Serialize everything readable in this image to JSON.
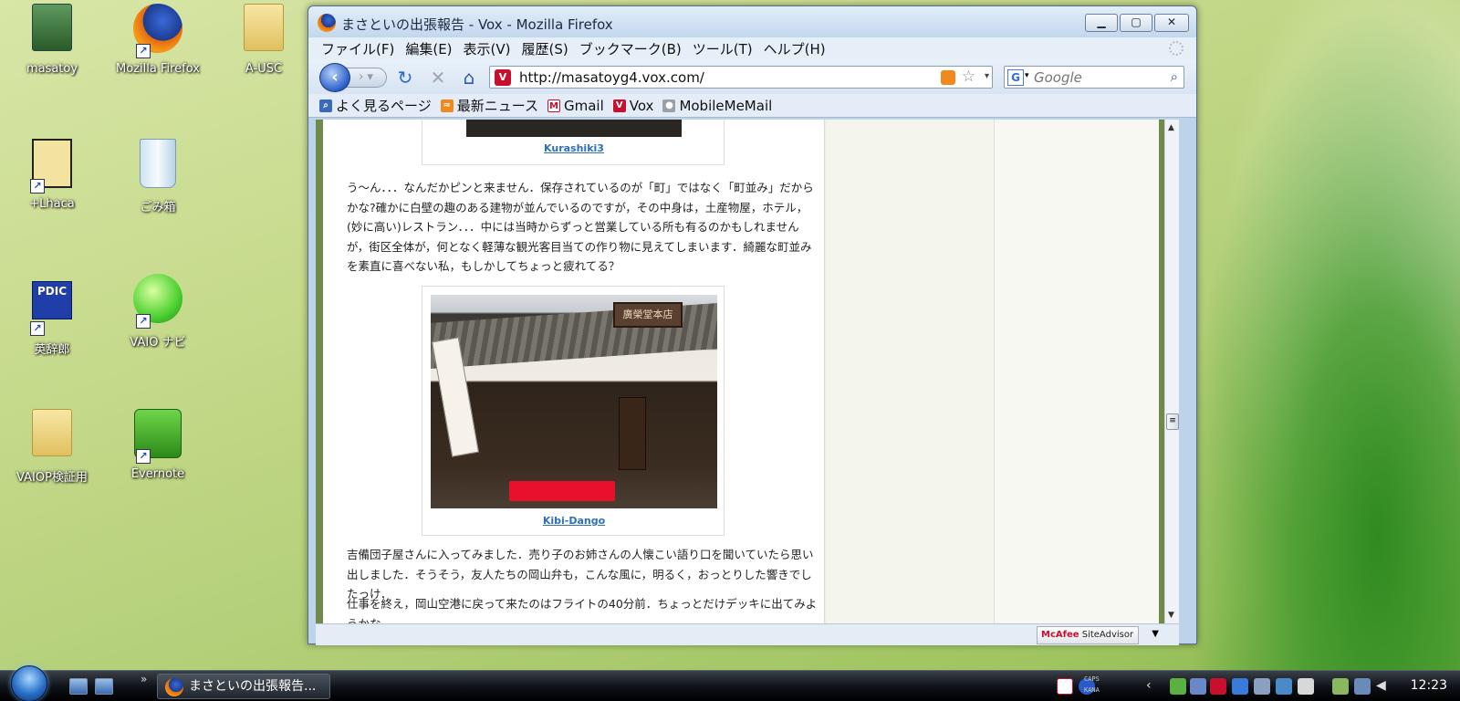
{
  "desktop": {
    "icons": [
      {
        "label": "masatoy"
      },
      {
        "label": "Mozilla Firefox"
      },
      {
        "label": "A-USC"
      },
      {
        "label": "+Lhaca"
      },
      {
        "label": "ごみ箱"
      },
      {
        "label": "英辞郎"
      },
      {
        "label": "VAIO ナビ"
      },
      {
        "label": "VAIOP検証用"
      },
      {
        "label": "Evernote"
      }
    ],
    "pdic_text": "PDIC"
  },
  "window": {
    "title": "まさといの出張報告 - Vox - Mozilla Firefox",
    "minimize": "▁",
    "maximize": "▢",
    "close": "✕"
  },
  "menu": [
    "ファイル(F)",
    "編集(E)",
    "表示(V)",
    "履歴(S)",
    "ブックマーク(B)",
    "ツール(T)",
    "ヘルプ(H)"
  ],
  "navbar": {
    "url": "http://masatoyg4.vox.com/",
    "search_placeholder": "Google",
    "vox_letter": "V",
    "google_letter": "G"
  },
  "bookmarks": [
    "よく見るページ",
    "最新ニュース",
    "Gmail",
    "Vox",
    "MobileMeMail"
  ],
  "post": {
    "caption1": "Kurashiki3",
    "para1": "う〜ん．．．なんだかピンと来ません．保存されているのが「町」ではなく「町並み」だからかな?確かに白壁の趣のある建物が並んでいるのですが，その中身は，土産物屋，ホテル，(妙に高い)レストラン．．．中には当時からずっと営業している所も有るのかもしれませんが，街区全体が，何となく軽薄な観光客目当ての作り物に見えてしまいます．綺麗な町並みを素直に喜べない私，もしかしてちょっと疲れてる？",
    "sign_text": "廣榮堂本店",
    "caption2": "Kibi-Dango",
    "para2": "吉備団子屋さんに入ってみました．売り子のお姉さんの人懐こい語り口を聞いていたら思い出しました．そうそう，友人たちの岡山弁も，こんな風に，明るく，おっとりした響きでしたっけ．",
    "para3": "仕事を終え，岡山空港に戻って来たのはフライトの40分前．ちょっとだけデッキに出てみようかな．．．"
  },
  "status": {
    "mcafee_brand": "McAfee",
    "mcafee_product": "SiteAdvisor"
  },
  "taskbar": {
    "task_title": "まさといの出張報告...",
    "caps": "CAPS",
    "kana": "KANA",
    "clock": "12:23"
  }
}
